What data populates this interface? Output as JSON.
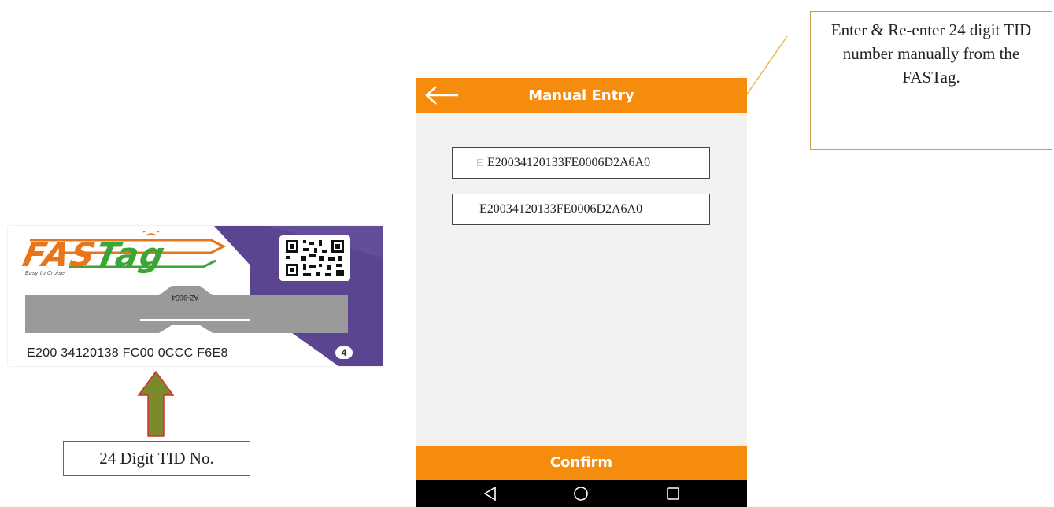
{
  "fastag_card": {
    "logo_fas": "FAS",
    "logo_tag": "Tag",
    "tagline": "Easy to Cruise",
    "serial": "E200 34120138 FC00 0CCC F6E8",
    "badge": "4",
    "antenna_code": "AZ-9654",
    "colors": {
      "purple": "#5b4590",
      "orange": "#e8751a",
      "green": "#3aa635"
    }
  },
  "tid_label": "24 Digit TID No.",
  "app": {
    "title": "Manual Entry",
    "tid_input_1": "E20034120133FE0006D2A6A0",
    "tid_input_2": "E20034120133FE0006D2A6A0",
    "confirm_label": "Confirm",
    "accent_color": "#f58c0e",
    "icons": [
      "back-arrow-icon",
      "nav-back-icon",
      "nav-home-icon",
      "nav-recents-icon"
    ]
  },
  "callout": {
    "text": "Enter & Re-enter 24 digit TID number manually from the FASTag."
  }
}
